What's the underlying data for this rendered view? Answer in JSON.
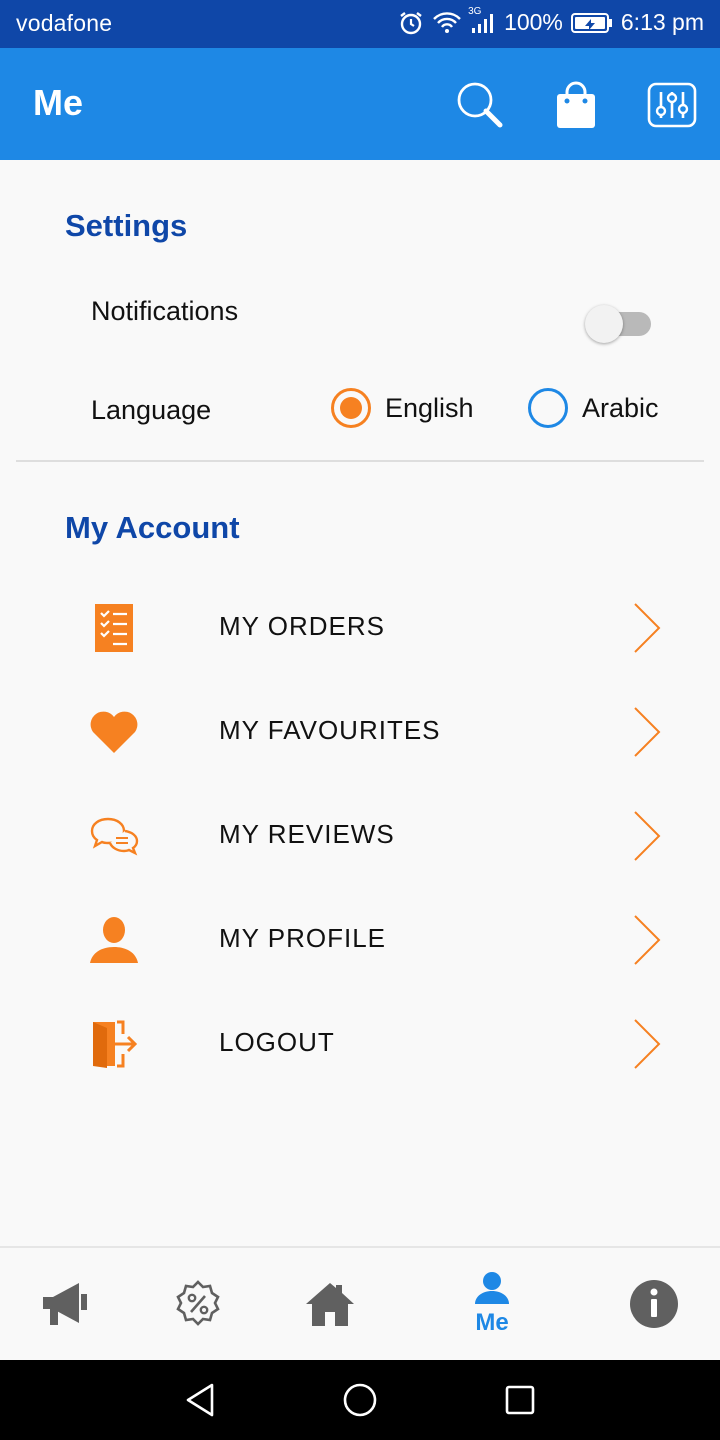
{
  "status_bar": {
    "carrier": "vodafone",
    "network": "3G",
    "battery": "100%",
    "time": "6:13 pm"
  },
  "app_bar": {
    "title": "Me",
    "actions": [
      "search-icon",
      "shopping-bag-icon",
      "filter-sliders-icon"
    ]
  },
  "settings": {
    "title": "Settings",
    "notifications_label": "Notifications",
    "notifications_on": false,
    "language_label": "Language",
    "language_options": [
      "English",
      "Arabic"
    ],
    "language_selected": "English"
  },
  "account": {
    "title": "My Account",
    "items": [
      {
        "label": "MY ORDERS",
        "icon": "orders-checklist-icon"
      },
      {
        "label": "MY FAVOURITES",
        "icon": "heart-icon"
      },
      {
        "label": "MY REVIEWS",
        "icon": "chat-bubbles-icon"
      },
      {
        "label": "MY PROFILE",
        "icon": "user-icon"
      },
      {
        "label": "LOGOUT",
        "icon": "logout-door-icon"
      }
    ]
  },
  "bottom_nav": {
    "items": [
      {
        "icon": "megaphone-icon",
        "label": ""
      },
      {
        "icon": "discount-badge-icon",
        "label": ""
      },
      {
        "icon": "home-icon",
        "label": ""
      },
      {
        "icon": "user-icon",
        "label": "Me",
        "active": true
      },
      {
        "icon": "info-icon",
        "label": ""
      }
    ]
  },
  "colors": {
    "status_bar": "#0f47a8",
    "app_bar": "#1e88e5",
    "section_title": "#0f47a8",
    "accent_orange": "#f68121",
    "nav_active": "#1e88e5",
    "nav_inactive": "#606060"
  }
}
